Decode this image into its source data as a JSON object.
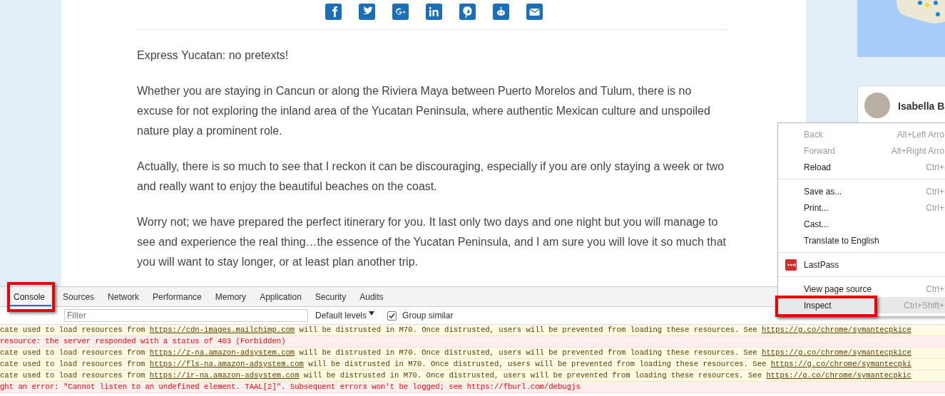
{
  "share_buttons": [
    {
      "kind": "facebook"
    },
    {
      "kind": "twitter"
    },
    {
      "kind": "google-plus"
    },
    {
      "kind": "linkedin"
    },
    {
      "kind": "pinterest"
    },
    {
      "kind": "reddit"
    },
    {
      "kind": "email"
    }
  ],
  "article": {
    "paragraphs": [
      "Express Yucatan: no pretexts!",
      "Whether you are staying in Cancun or along the Riviera Maya between Puerto Morelos and Tulum, there is no excuse for not exploring the inland area of the Yucatan Peninsula, where authentic Mexican culture and unspoiled nature play a prominent role.",
      "Actually, there is so much to see that I reckon it can be discouraging, especially if you are only staying a week or two and really want to enjoy the beautiful beaches on the coast.",
      "Worry not; we have prepared the perfect itinerary for you. It last only two days and one night but you will manage to see and experience the real thing…the essence of the Yucatan Peninsula, and I am sure you will love it so much that you will want to stay longer, or at least plan another trip."
    ]
  },
  "sidebar": {
    "profile_name": "Isabella B"
  },
  "context_menu": {
    "groups": [
      [
        {
          "label": "Back",
          "shortcut": "Alt+Left Arro",
          "disabled": true,
          "highlighted": false
        },
        {
          "label": "Forward",
          "shortcut": "Alt+Right Arro",
          "disabled": true,
          "highlighted": false
        },
        {
          "label": "Reload",
          "shortcut": "Ctrl+",
          "disabled": false,
          "highlighted": false
        }
      ],
      [
        {
          "label": "Save as...",
          "shortcut": "Ctrl+",
          "disabled": false,
          "highlighted": false
        },
        {
          "label": "Print...",
          "shortcut": "Ctrl+",
          "disabled": false,
          "highlighted": false
        },
        {
          "label": "Cast...",
          "disabled": false,
          "highlighted": false
        },
        {
          "label": "Translate to English",
          "disabled": false,
          "highlighted": false
        }
      ],
      [
        {
          "label": "LastPass",
          "kind": "extension",
          "disabled": false,
          "highlighted": false
        }
      ],
      [
        {
          "label": "View page source",
          "shortcut": "Ctrl+",
          "disabled": false,
          "highlighted": false
        },
        {
          "label": "Inspect",
          "shortcut": "Ctrl+Shift+",
          "disabled": false,
          "highlighted": true
        }
      ]
    ]
  },
  "devtools": {
    "tabs": [
      {
        "label": "Console",
        "selected": true
      },
      {
        "label": "Sources",
        "selected": false
      },
      {
        "label": "Network",
        "selected": false
      },
      {
        "label": "Performance",
        "selected": false
      },
      {
        "label": "Memory",
        "selected": false
      },
      {
        "label": "Application",
        "selected": false
      },
      {
        "label": "Security",
        "selected": false
      },
      {
        "label": "Audits",
        "selected": false
      }
    ],
    "filter": {
      "placeholder": "Filter"
    },
    "levels": "Default levels",
    "group_similar": {
      "label": "Group similar",
      "checked": true
    },
    "log": [
      {
        "kind": "warning",
        "parts": [
          {
            "kind": "text",
            "text": "cate used to load resources from "
          },
          {
            "kind": "link",
            "text": "https://cdn-images.mailchimp.com"
          },
          {
            "kind": "text",
            "text": " will be distrusted in M70. Once distrusted, users will be prevented from loading these resources. See "
          },
          {
            "kind": "link",
            "text": "https://g.co/chrome/symantecpkice"
          }
        ]
      },
      {
        "kind": "error",
        "parts": [
          {
            "kind": "text",
            "text": "resource: the server responded with a status of 403 (Forbidden)"
          }
        ]
      },
      {
        "kind": "warning",
        "parts": [
          {
            "kind": "text",
            "text": "cate used to load resources from "
          },
          {
            "kind": "link",
            "text": "https://z-na.amazon-adsystem.com"
          },
          {
            "kind": "text",
            "text": " will be distrusted in M70. Once distrusted, users will be prevented from loading these resources. See "
          },
          {
            "kind": "link",
            "text": "https://g.co/chrome/symantecpkice"
          }
        ]
      },
      {
        "kind": "warning",
        "parts": [
          {
            "kind": "text",
            "text": "cate used to load resources from "
          },
          {
            "kind": "link",
            "text": "https://fls-na.amazon-adsystem.com"
          },
          {
            "kind": "text",
            "text": " will be distrusted in M70. Once distrusted, users will be prevented from loading these resources. See "
          },
          {
            "kind": "link",
            "text": "https://g.co/chrome/symantecpki"
          }
        ]
      },
      {
        "kind": "warning",
        "parts": [
          {
            "kind": "text",
            "text": "cate used to load resources from "
          },
          {
            "kind": "link",
            "text": "https://ir-na.amazon-adsystem.com"
          },
          {
            "kind": "text",
            "text": " will be distrusted in M70. Once distrusted, users will be prevented from loading these resources. See "
          },
          {
            "kind": "link",
            "text": "https://g.co/chrome/symantecpkic"
          }
        ]
      },
      {
        "kind": "error",
        "parts": [
          {
            "kind": "text",
            "text": "ght an error: \"Cannot listen to an undefined element. TAAL[2]\". Subsequent errors won't be logged; see https://fburl.com/debugjs"
          }
        ]
      }
    ]
  }
}
